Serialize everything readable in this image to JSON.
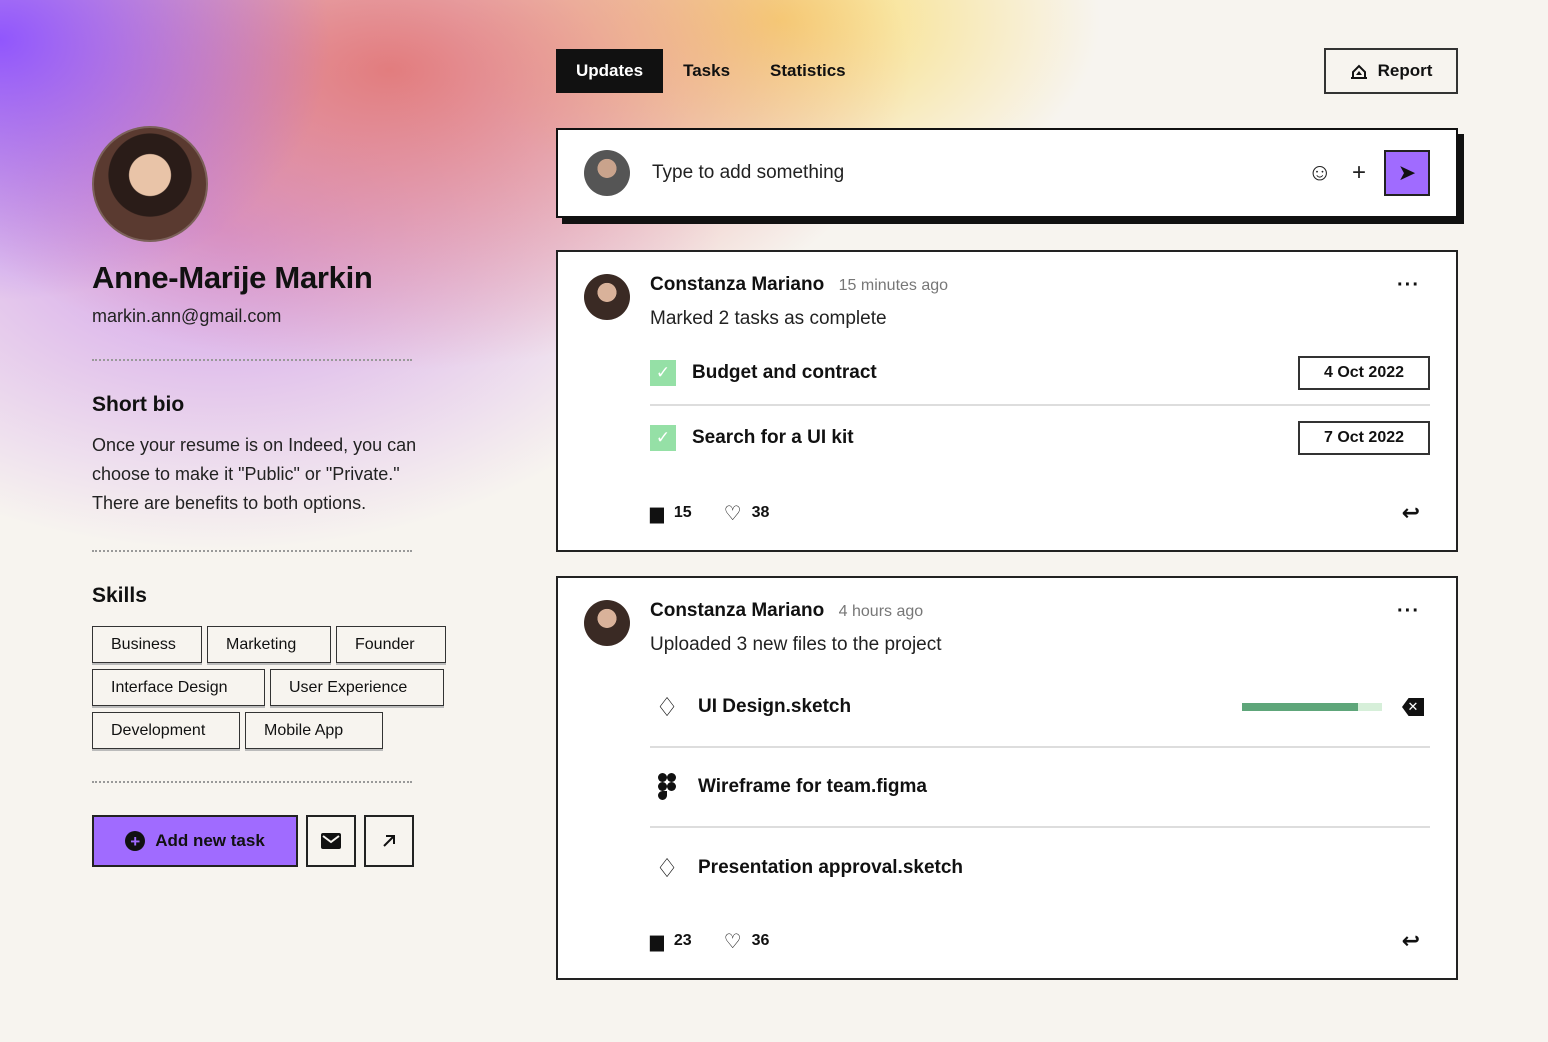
{
  "profile": {
    "name": "Anne-Marije Markin",
    "email": "markin.ann@gmail.com",
    "bio_title": "Short bio",
    "bio_lines": [
      "Once your resume is on Indeed, you can",
      "choose to make it \"Public\" or \"Private.\"",
      "There are benefits to both options."
    ],
    "skills_title": "Skills",
    "skills": [
      "Business",
      "Marketing",
      "Founder",
      "Interface Design",
      "User Experience",
      "Development",
      "Mobile App"
    ],
    "add_task_label": "Add new task"
  },
  "tabs": [
    "Updates",
    "Tasks",
    "Statistics"
  ],
  "report_label": "Report",
  "composer": {
    "placeholder": "Type to add something"
  },
  "feed": [
    {
      "author": "Constanza Mariano",
      "time": "15 minutes ago",
      "message": "Marked 2 tasks as complete",
      "tasks": [
        {
          "title": "Budget and contract",
          "date": "4 Oct 2022"
        },
        {
          "title": "Search for a UI kit",
          "date": "7 Oct 2022"
        }
      ],
      "comments": "15",
      "likes": "38"
    },
    {
      "author": "Constanza Mariano",
      "time": "4 hours ago",
      "message": "Uploaded 3 new files to the project",
      "files": [
        {
          "name": "UI Design.sketch",
          "icon": "sketch-icon",
          "progress": 0.83
        },
        {
          "name": "Wireframe for team.figma",
          "icon": "figma-icon"
        },
        {
          "name": "Presentation approval.sketch",
          "icon": "sketch-icon"
        }
      ],
      "comments": "23",
      "likes": "36"
    }
  ],
  "colors": {
    "accent": "#a06bff",
    "check": "#95e0a6",
    "progress": "#5ea67a"
  }
}
